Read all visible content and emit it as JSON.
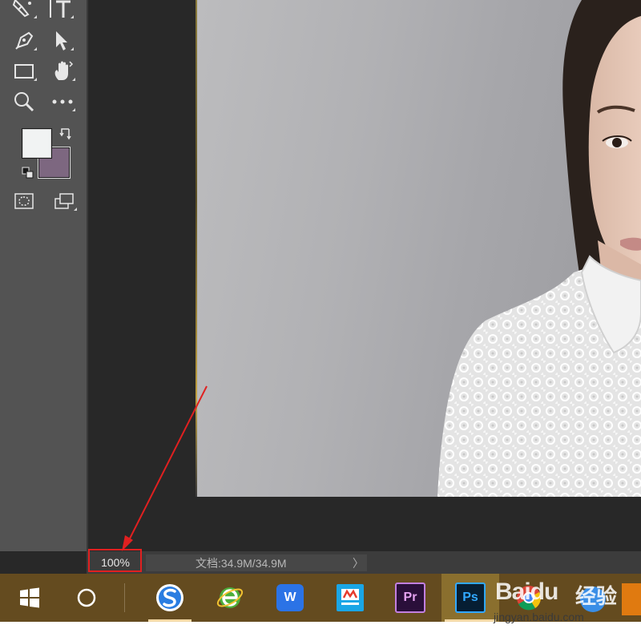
{
  "app": {
    "name": "Photoshop",
    "foreground_color": "#f1f3f3",
    "background_color": "#7d6780"
  },
  "toolbar": {
    "tools": [
      {
        "id": "brush",
        "icon": "brush-icon"
      },
      {
        "id": "type",
        "icon": "type-tool-icon"
      },
      {
        "id": "pen",
        "icon": "pen-tool-icon"
      },
      {
        "id": "path-selection",
        "icon": "path-selection-icon"
      },
      {
        "id": "rectangle",
        "icon": "rectangle-tool-icon"
      },
      {
        "id": "hand",
        "icon": "hand-tool-icon"
      },
      {
        "id": "zoom",
        "icon": "zoom-tool-icon"
      },
      {
        "id": "more",
        "icon": "more-tools-icon"
      },
      {
        "id": "quick-mask",
        "icon": "quick-mask-icon"
      },
      {
        "id": "screen-mode",
        "icon": "screen-mode-icon"
      }
    ]
  },
  "status": {
    "zoom": "100%",
    "doc_info": "文档:34.9M/34.9M",
    "arrow": "〉"
  },
  "taskbar": {
    "items": [
      {
        "id": "start",
        "icon": "windows-start-icon"
      },
      {
        "id": "cortana",
        "icon": "cortana-circle-icon"
      },
      {
        "id": "sogou",
        "icon": "sogou-browser-icon"
      },
      {
        "id": "ie",
        "icon": "ie-browser-icon"
      },
      {
        "id": "wps",
        "icon": "wps-icon",
        "label": "W"
      },
      {
        "id": "baidu-netdisk",
        "icon": "baidu-netdisk-icon"
      },
      {
        "id": "premiere",
        "icon": "premiere-icon",
        "label": "Pr"
      },
      {
        "id": "photoshop",
        "icon": "photoshop-icon",
        "label": "Ps"
      }
    ],
    "accent": "#644b1f"
  },
  "watermark": {
    "brand": "Baidu",
    "brand_cn": "经验",
    "url": "jingyan.baidu.com"
  }
}
